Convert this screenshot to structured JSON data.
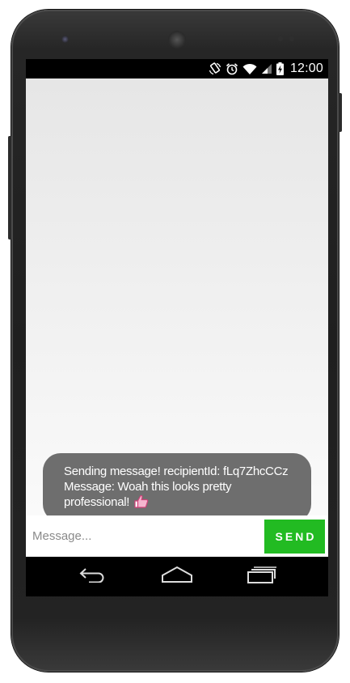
{
  "status_bar": {
    "time": "12:00",
    "icons": [
      "rotate-icon",
      "alarm-icon",
      "wifi-icon",
      "signal-icon",
      "battery-charging-icon"
    ]
  },
  "toast": {
    "line1": "Sending message! recipientId: fLq7ZhcCCz",
    "line2": "Message: Woah this looks pretty",
    "line3": "professional!",
    "emoji_icon": "thumbs-up-icon"
  },
  "composer": {
    "placeholder": "Message...",
    "value": "",
    "send_label": "SEND"
  },
  "navigation": {
    "icons": [
      "back-icon",
      "home-icon",
      "recents-icon"
    ]
  },
  "colors": {
    "send_button": "#22bb22",
    "toast_background": "#6e6e6e",
    "app_background": "#eeeeee"
  }
}
